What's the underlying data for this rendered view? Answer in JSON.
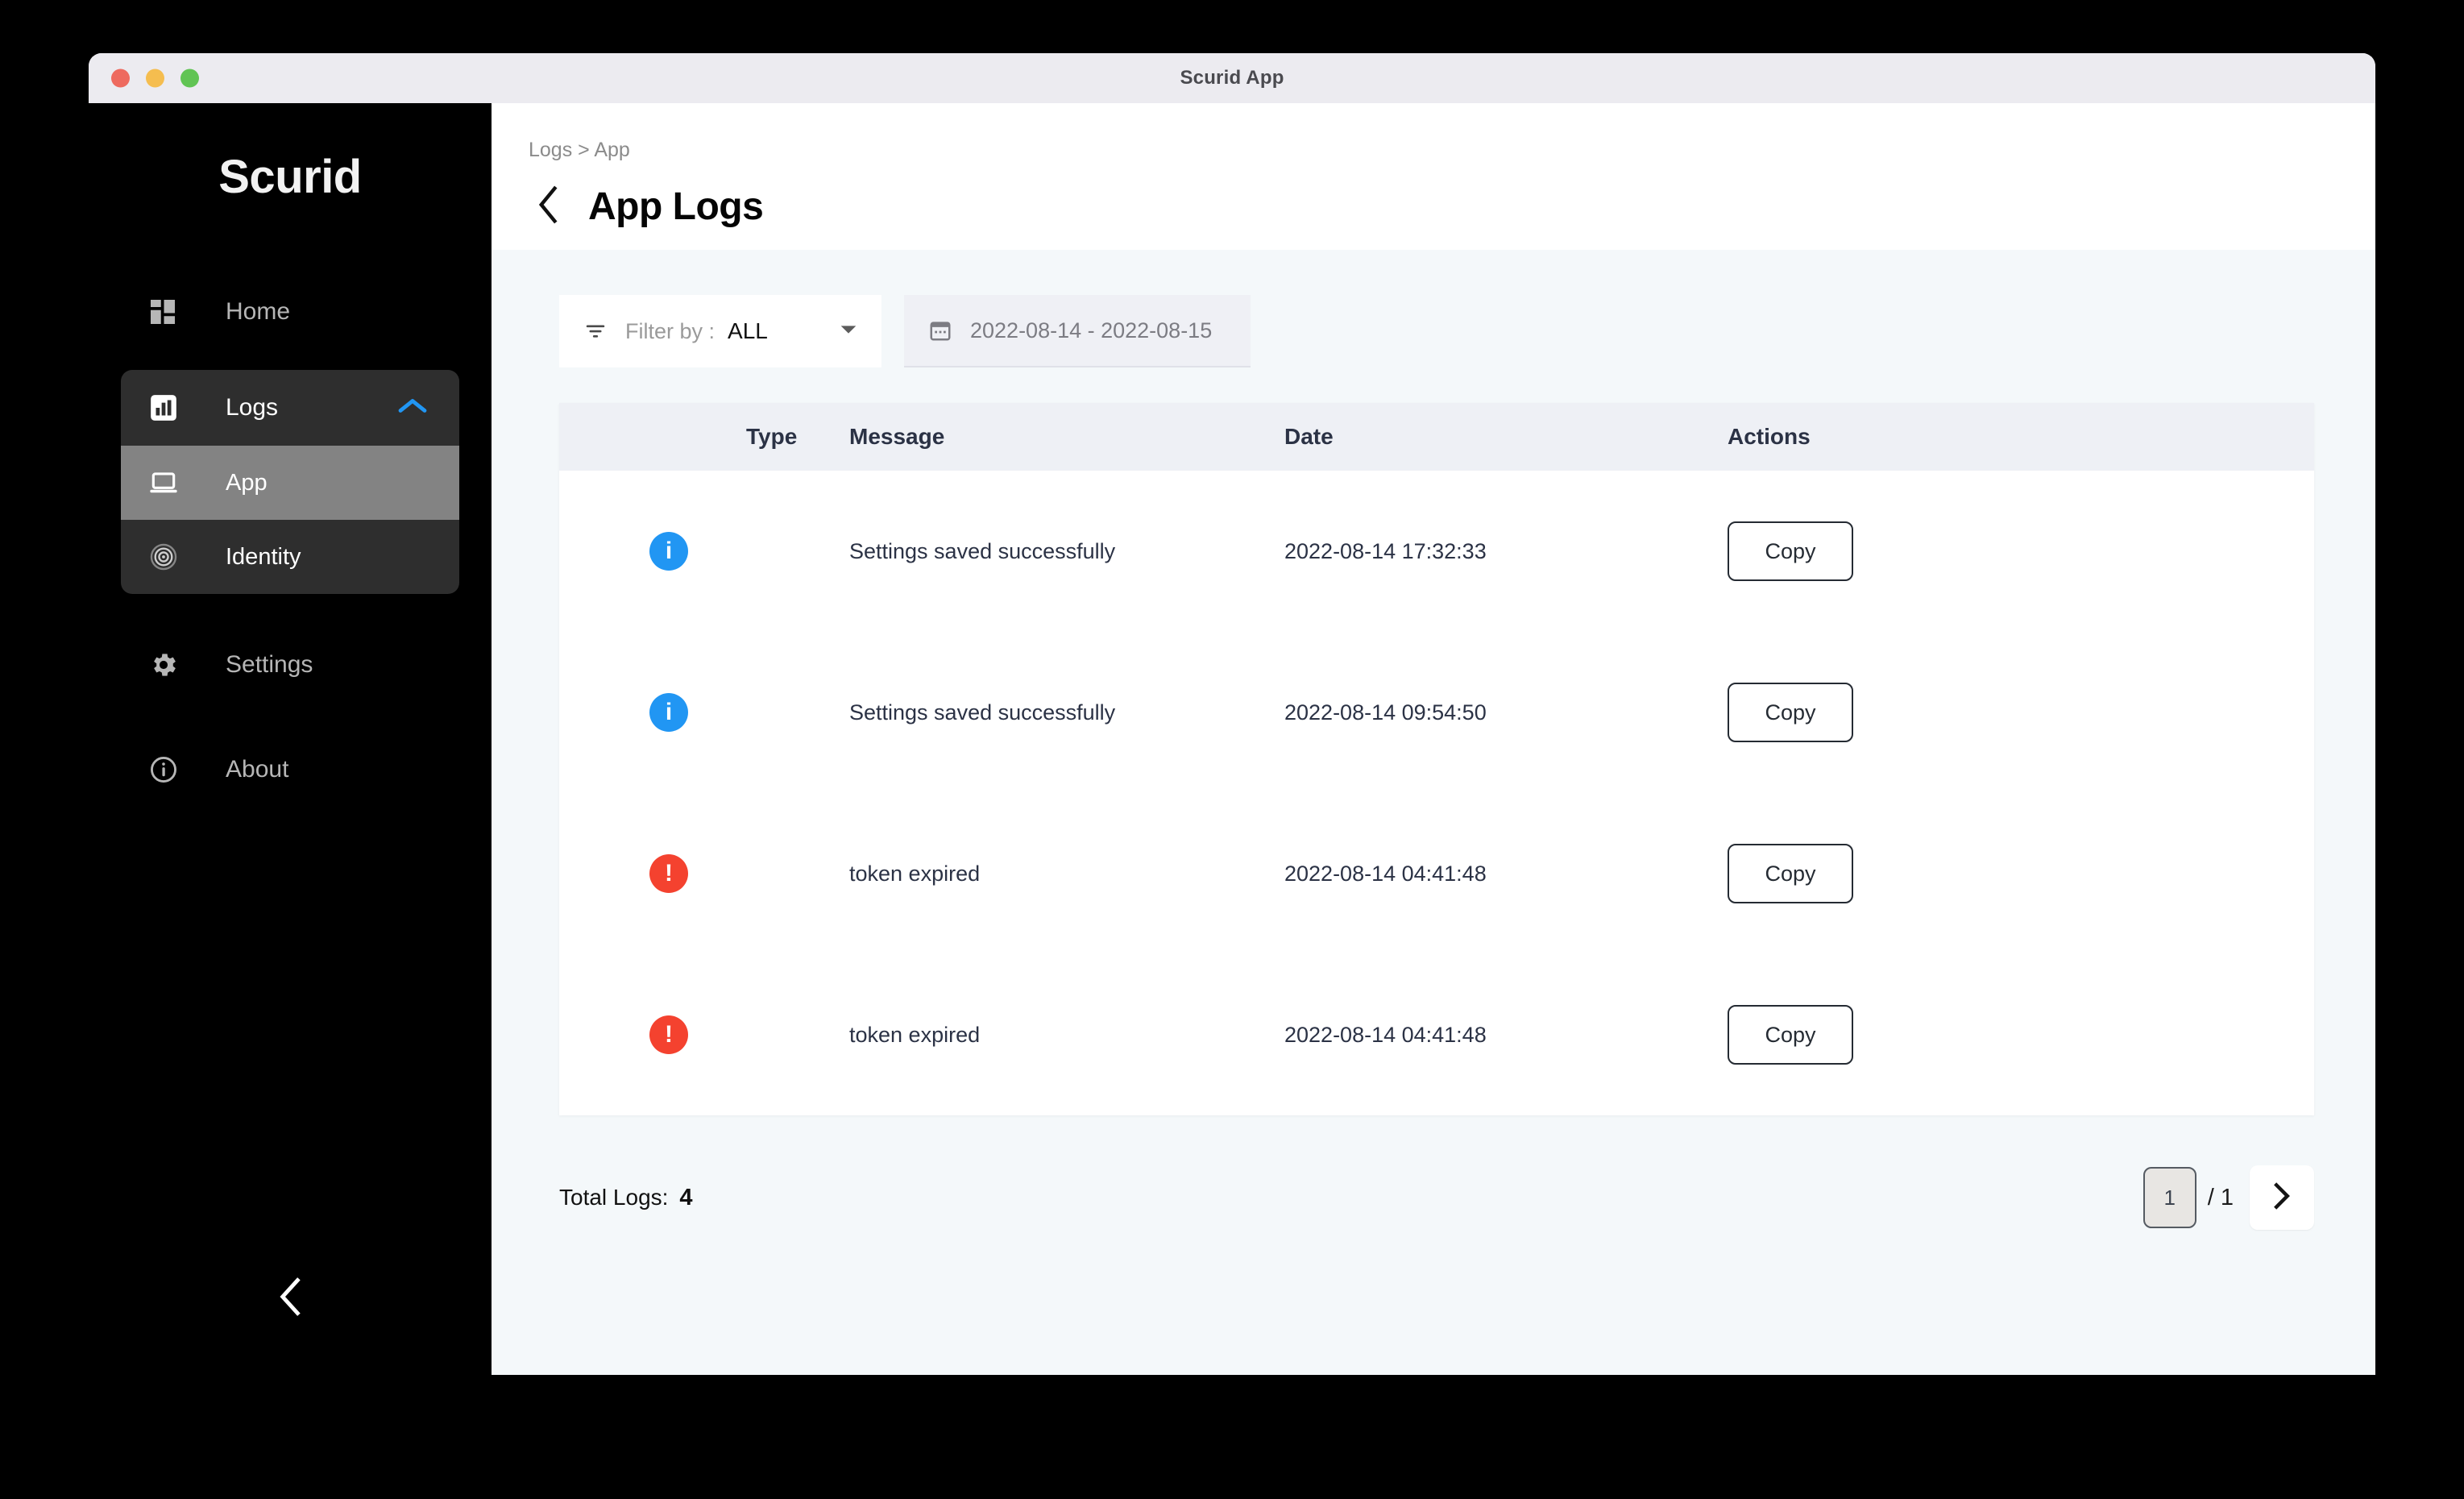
{
  "window": {
    "title": "Scurid App",
    "traffic_lights": [
      "close-red",
      "minimize-yellow",
      "maximize-green"
    ]
  },
  "sidebar": {
    "brand": "Scurid",
    "home": {
      "label": "Home",
      "icon": "dashboard-icon"
    },
    "logs_group": {
      "label": "Logs",
      "icon": "bar-chart-icon",
      "expanded_icon": "chevron-up-icon",
      "items": [
        {
          "label": "App",
          "icon": "laptop-icon",
          "active": true
        },
        {
          "label": "Identity",
          "icon": "fingerprint-icon",
          "active": false
        }
      ]
    },
    "settings": {
      "label": "Settings",
      "icon": "gear-icon"
    },
    "about": {
      "label": "About",
      "icon": "info-circle-icon"
    },
    "collapse": {
      "icon": "chevron-left-icon"
    }
  },
  "header": {
    "breadcrumb": "Logs > App",
    "back_icon": "chevron-left-icon",
    "title": "App Logs"
  },
  "filters": {
    "filter_icon": "filter-icon",
    "filter_label": "Filter by :",
    "filter_value": "ALL",
    "caret_icon": "caret-down-icon",
    "calendar_icon": "calendar-icon",
    "date_range": "2022-08-14 - 2022-08-15"
  },
  "table": {
    "columns": [
      "Type",
      "Message",
      "Date",
      "Actions"
    ],
    "rows": [
      {
        "type": "info",
        "type_glyph": "i",
        "message": "Settings saved successfully",
        "date": "2022-08-14 17:32:33",
        "action": "Copy"
      },
      {
        "type": "info",
        "type_glyph": "i",
        "message": "Settings saved successfully",
        "date": "2022-08-14 09:54:50",
        "action": "Copy"
      },
      {
        "type": "error",
        "type_glyph": "!",
        "message": "token expired",
        "date": "2022-08-14 04:41:48",
        "action": "Copy"
      },
      {
        "type": "error",
        "type_glyph": "!",
        "message": "token expired",
        "date": "2022-08-14 04:41:48",
        "action": "Copy"
      }
    ]
  },
  "footer": {
    "total_label": "Total Logs:",
    "total_value": "4",
    "page_value": "1",
    "page_of": "/ 1",
    "next_icon": "chevron-right-icon"
  },
  "colors": {
    "sidebar_bg": "#000000",
    "info_badge": "#2196f3",
    "error_badge": "#f4422f",
    "accent_blue": "#2196f3",
    "content_bg": "#f4f8fa",
    "table_header_bg": "#eef0f5"
  }
}
